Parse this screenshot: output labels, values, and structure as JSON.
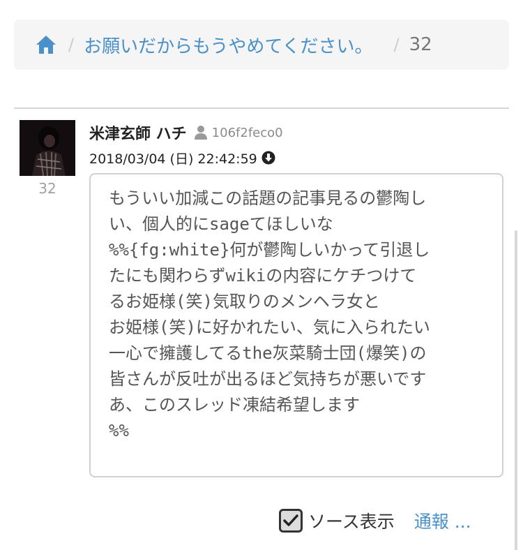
{
  "breadcrumb": {
    "home_icon": "home-icon",
    "separator": "/",
    "thread_title": "お願いだからもうやめてください。",
    "current": "32"
  },
  "post": {
    "number": "32",
    "author": "米津玄師 ハチ",
    "user_icon": "user-icon",
    "user_id": "106f2feco0",
    "date": "2018/03/04 (日) 22:42:59",
    "download_icon": "download-circle-icon",
    "body_lines": [
      "もういい加減この話題の記事見るの鬱陶し",
      "い、個人的にsageてほしいな",
      "%%{fg:white}何が鬱陶しいかって引退し",
      "たにも関わらずwikiの内容にケチつけて",
      "るお姫様(笑)気取りのメンヘラ女と",
      "お姫様(笑)に好かれたい、気に入られたい",
      "一心で擁護してるthe灰菜騎士団(爆笑)の",
      "皆さんが反吐が出るほど気持ちが悪いです",
      "あ、このスレッド凍結希望します",
      "%%"
    ]
  },
  "footer": {
    "source_checked": true,
    "source_label": "ソース表示",
    "report_label": "通報 ..."
  },
  "colors": {
    "link": "#4a90c9",
    "breadcrumb_bg": "#f5f5f5",
    "border": "#d0d0d0"
  }
}
